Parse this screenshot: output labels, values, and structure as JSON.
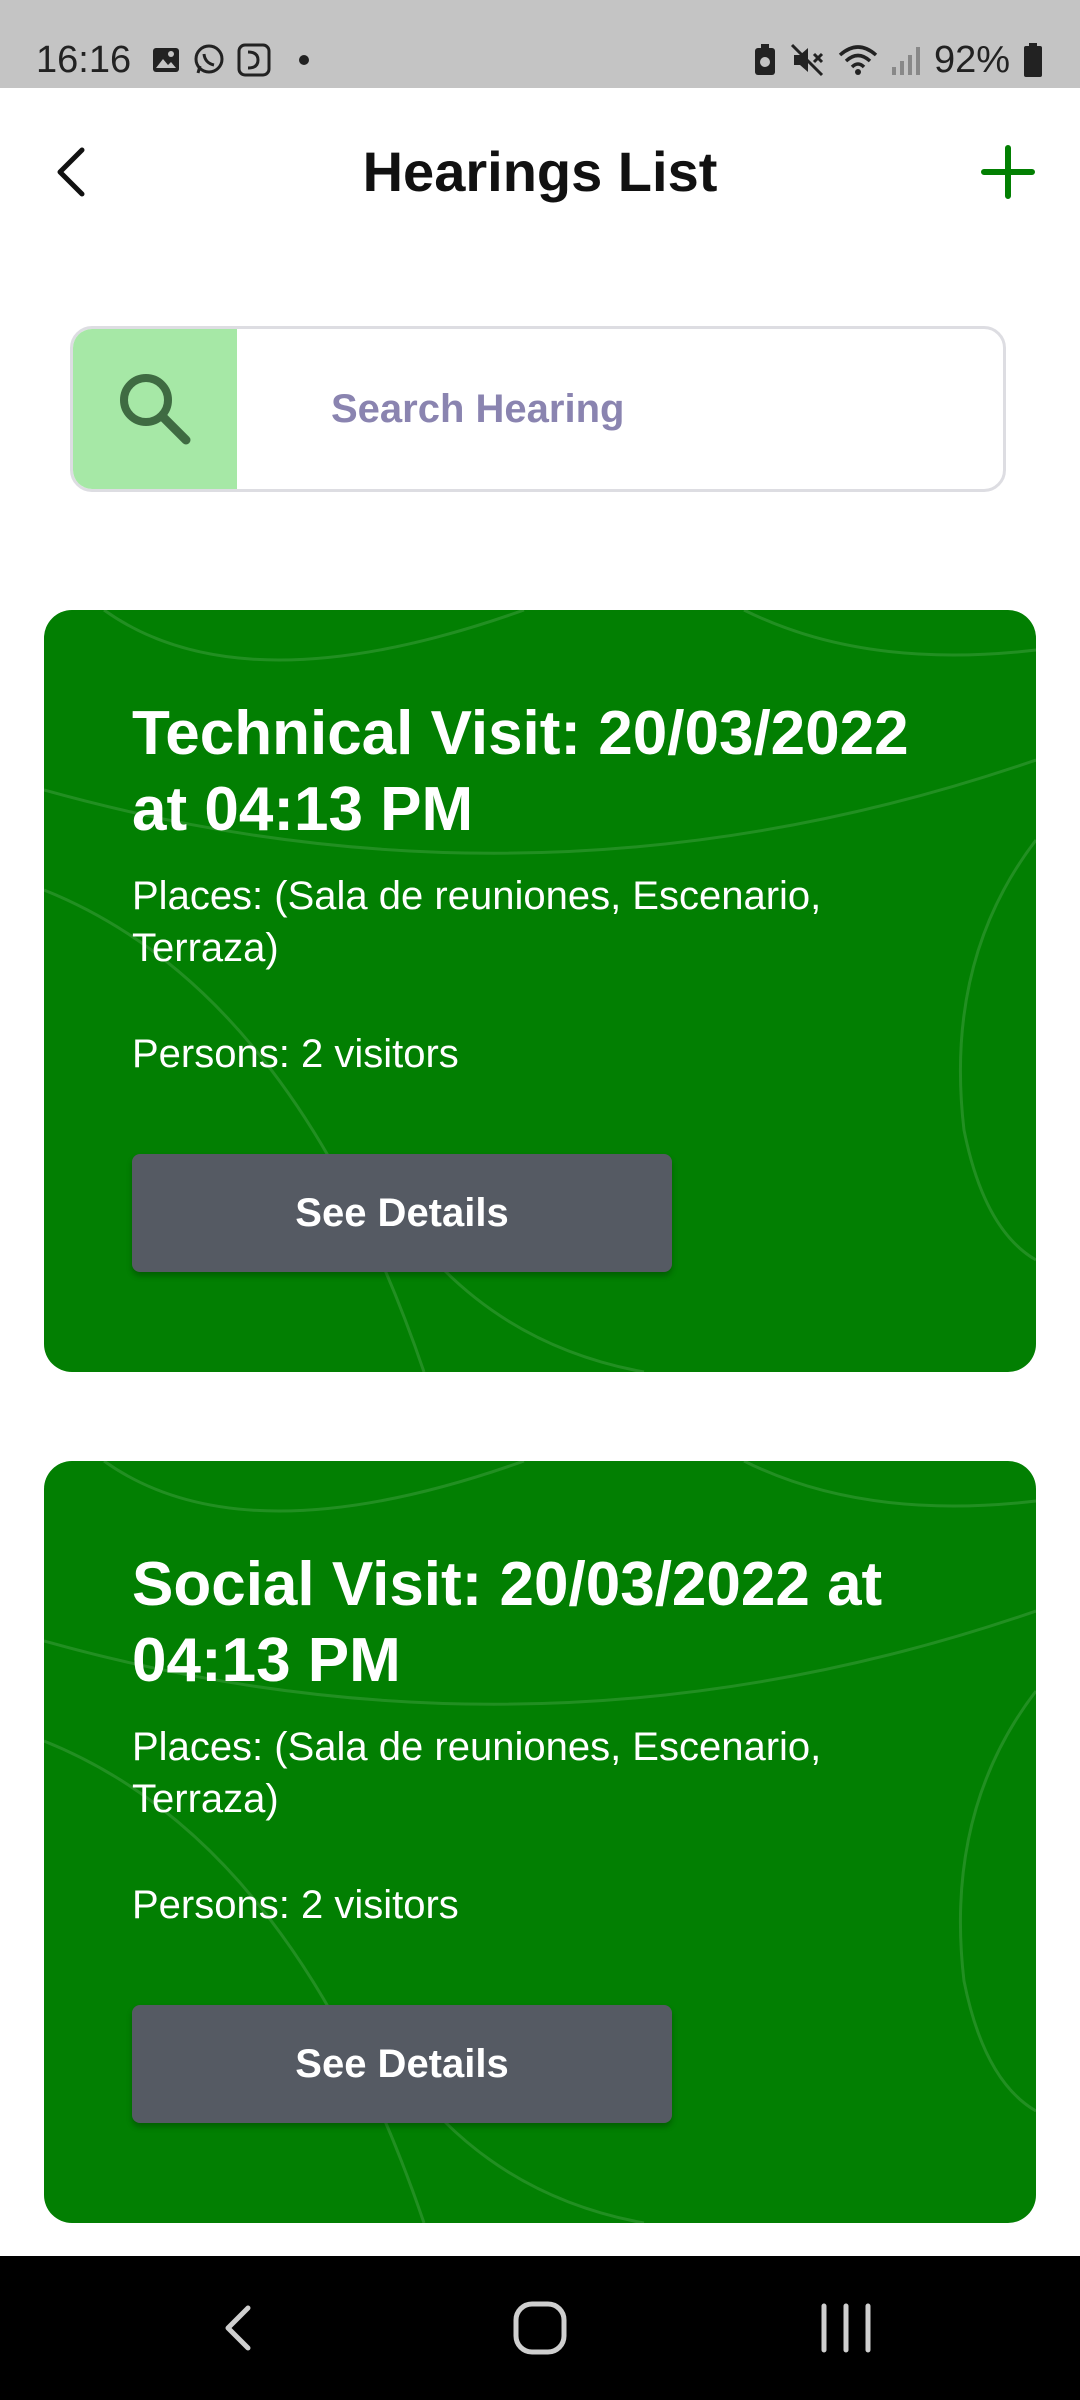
{
  "status_bar": {
    "time": "16:16",
    "battery": "92%",
    "icons_left": [
      "gallery-icon",
      "whatsapp-icon",
      "app-icon",
      "dot-icon"
    ],
    "icons_right": [
      "battery-saver-icon",
      "mute-icon",
      "wifi-icon",
      "signal-icon",
      "battery-icon"
    ]
  },
  "header": {
    "title": "Hearings List",
    "back_icon": "chevron-left-icon",
    "add_icon": "plus-icon"
  },
  "search": {
    "placeholder": "Search Hearing",
    "value": "",
    "icon": "search-icon"
  },
  "cards": [
    {
      "title": "Technical Visit: 20/03/2022 at 04:13 PM",
      "places": "Places: (Sala de reuniones, Escenario, Terraza)",
      "persons": "Persons: 2 visitors",
      "button": "See Details"
    },
    {
      "title": "Social Visit: 20/03/2022 at 04:13 PM",
      "places": "Places: (Sala de reuniones, Escenario, Terraza)",
      "persons": "Persons: 2 visitors",
      "button": "See Details"
    }
  ],
  "nav": {
    "back": "nav-back-icon",
    "home": "nav-home-icon",
    "recents": "nav-recents-icon"
  },
  "colors": {
    "accent": "#027f02",
    "search_icon_bg": "#a6e8a6",
    "button": "#555a63",
    "placeholder": "#8a84b0"
  }
}
